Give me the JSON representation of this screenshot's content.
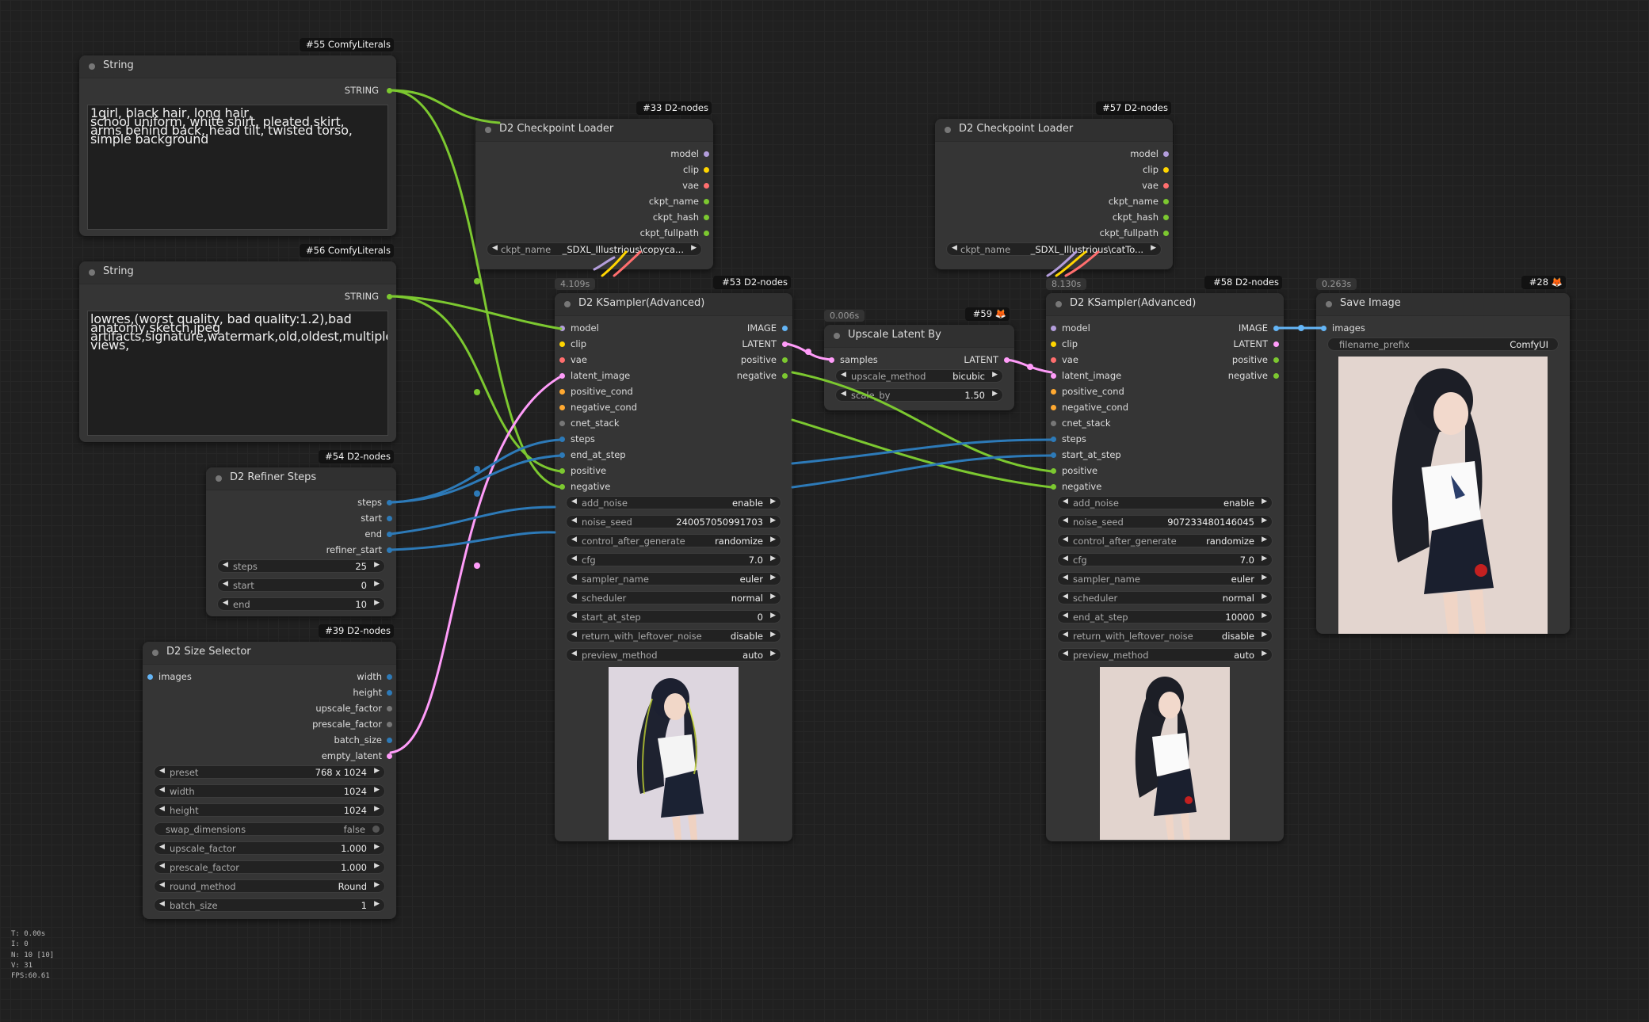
{
  "nodes": {
    "string55": {
      "badge": "#55 ComfyLiterals",
      "title": "String",
      "out": "STRING",
      "text": "1girl, black hair, long hair,\nschool uniform, white shirt, pleated skirt,\narms behind back, head tilt, twisted torso,\nsimple background"
    },
    "string56": {
      "badge": "#56 ComfyLiterals",
      "title": "String",
      "out": "STRING",
      "text": "lowres,(worst quality, bad quality:1.2),bad\nanatomy,sketch,jpeg\nartifacts,signature,watermark,old,oldest,multiple\nviews,"
    },
    "refiner54": {
      "badge": "#54 D2-nodes",
      "title": "D2 Refiner Steps",
      "outs": [
        "steps",
        "start",
        "end",
        "refiner_start"
      ],
      "widgets": [
        {
          "label": "steps",
          "value": "25"
        },
        {
          "label": "start",
          "value": "0"
        },
        {
          "label": "end",
          "value": "10"
        }
      ]
    },
    "size39": {
      "badge": "#39 D2-nodes",
      "title": "D2 Size Selector",
      "in": "images",
      "outs": [
        "width",
        "height",
        "upscale_factor",
        "prescale_factor",
        "batch_size",
        "empty_latent"
      ],
      "widgets": [
        {
          "label": "preset",
          "value": "768 x 1024"
        },
        {
          "label": "width",
          "value": "1024"
        },
        {
          "label": "height",
          "value": "1024"
        },
        {
          "label": "swap_dimensions",
          "value": "false",
          "toggle": true
        },
        {
          "label": "upscale_factor",
          "value": "1.000"
        },
        {
          "label": "prescale_factor",
          "value": "1.000"
        },
        {
          "label": "round_method",
          "value": "Round"
        },
        {
          "label": "batch_size",
          "value": "1"
        }
      ]
    },
    "ckpt33": {
      "badge": "#33 D2-nodes",
      "title": "D2 Checkpoint Loader",
      "outs": [
        "model",
        "clip",
        "vae",
        "ckpt_name",
        "ckpt_hash",
        "ckpt_fullpath"
      ],
      "widget": {
        "label": "ckpt_name",
        "value": "_SDXL_Illustrious\\copyca..."
      }
    },
    "ckpt57": {
      "badge": "#57 D2-nodes",
      "title": "D2 Checkpoint Loader",
      "outs": [
        "model",
        "clip",
        "vae",
        "ckpt_name",
        "ckpt_hash",
        "ckpt_fullpath"
      ],
      "widget": {
        "label": "ckpt_name",
        "value": "_SDXL_Illustrious\\catTo..."
      }
    },
    "ks53": {
      "badge": "#53 D2-nodes",
      "timing": "4.109s",
      "title": "D2 KSampler(Advanced)",
      "ins": [
        "model",
        "clip",
        "vae",
        "latent_image",
        "positive_cond",
        "negative_cond",
        "cnet_stack",
        "steps",
        "end_at_step",
        "positive",
        "negative"
      ],
      "outs": [
        "IMAGE",
        "LATENT",
        "positive",
        "negative"
      ],
      "widgets": [
        {
          "label": "add_noise",
          "value": "enable"
        },
        {
          "label": "noise_seed",
          "value": "240057050991703"
        },
        {
          "label": "control_after_generate",
          "value": "randomize"
        },
        {
          "label": "cfg",
          "value": "7.0"
        },
        {
          "label": "sampler_name",
          "value": "euler"
        },
        {
          "label": "scheduler",
          "value": "normal"
        },
        {
          "label": "start_at_step",
          "value": "0"
        },
        {
          "label": "return_with_leftover_noise",
          "value": "disable"
        },
        {
          "label": "preview_method",
          "value": "auto"
        }
      ]
    },
    "up59": {
      "badge": "#59 🦊",
      "timing": "0.006s",
      "title": "Upscale Latent By",
      "in": "samples",
      "out": "LATENT",
      "widgets": [
        {
          "label": "upscale_method",
          "value": "bicubic"
        },
        {
          "label": "scale_by",
          "value": "1.50"
        }
      ]
    },
    "ks58": {
      "badge": "#58 D2-nodes",
      "timing": "8.130s",
      "title": "D2 KSampler(Advanced)",
      "ins": [
        "model",
        "clip",
        "vae",
        "latent_image",
        "positive_cond",
        "negative_cond",
        "cnet_stack",
        "steps",
        "start_at_step",
        "positive",
        "negative"
      ],
      "outs": [
        "IMAGE",
        "LATENT",
        "positive",
        "negative"
      ],
      "widgets": [
        {
          "label": "add_noise",
          "value": "enable"
        },
        {
          "label": "noise_seed",
          "value": "907233480146045"
        },
        {
          "label": "control_after_generate",
          "value": "randomize"
        },
        {
          "label": "cfg",
          "value": "7.0"
        },
        {
          "label": "sampler_name",
          "value": "euler"
        },
        {
          "label": "scheduler",
          "value": "normal"
        },
        {
          "label": "end_at_step",
          "value": "10000"
        },
        {
          "label": "return_with_leftover_noise",
          "value": "disable"
        },
        {
          "label": "preview_method",
          "value": "auto"
        }
      ]
    },
    "save28": {
      "badge": "#28 🦊",
      "timing": "0.263s",
      "title": "Save Image",
      "in": "images",
      "widget": {
        "label": "filename_prefix",
        "value": "ComfyUI"
      }
    }
  },
  "stats": {
    "t": "T: 0.00s",
    "i": "I: 0",
    "n": "N: 10 [10]",
    "v": "V: 31",
    "fps": "FPS:60.61"
  },
  "colors": {
    "model": "#b39ddb",
    "clip": "#ffd500",
    "vae": "#ff6e6e",
    "latent": "#ff9cf9",
    "string": "#7cc830",
    "int": "#2d7ab8",
    "image": "#64b5f6",
    "cond": "#ffa931",
    "grey": "#777777"
  }
}
